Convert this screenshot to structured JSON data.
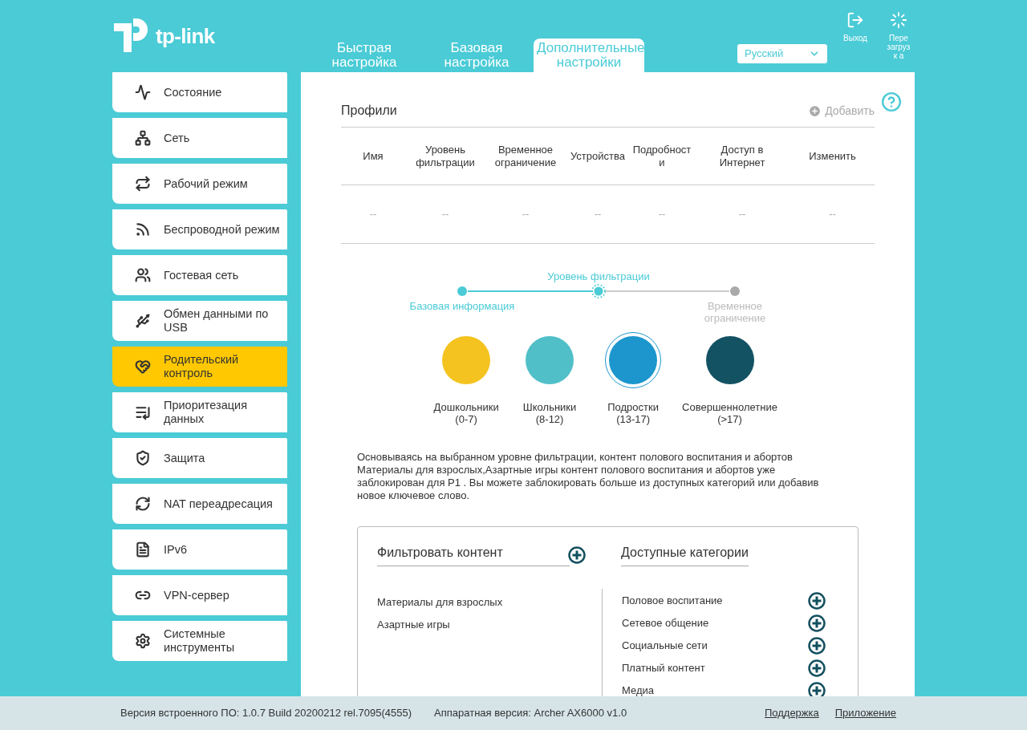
{
  "header": {
    "logo": "tp-link",
    "tabs": [
      {
        "label": "Быстрая настройка",
        "selected": false
      },
      {
        "label": "Базовая настройка",
        "selected": false
      },
      {
        "label": "Дополнительные настройки",
        "selected": true
      }
    ],
    "language": "Русский",
    "actions": [
      {
        "kind": "logout",
        "label": "Выход"
      },
      {
        "kind": "reboot",
        "label": "Пере загрузк а"
      }
    ]
  },
  "sidebar": {
    "items": [
      {
        "label": "Состояние",
        "selected": false
      },
      {
        "label": "Сеть",
        "selected": false
      },
      {
        "label": "Рабочий режим",
        "selected": false
      },
      {
        "label": "Беспроводной режим",
        "selected": false
      },
      {
        "label": "Гостевая сеть",
        "selected": false
      },
      {
        "label": "Обмен данными по USB",
        "selected": false
      },
      {
        "label": "Родительский контроль",
        "selected": true
      },
      {
        "label": "Приоритезация данных",
        "selected": false
      },
      {
        "label": "Защита",
        "selected": false
      },
      {
        "label": "NAT переадресация",
        "selected": false
      },
      {
        "label": "IPv6",
        "selected": false
      },
      {
        "label": "VPN-сервер",
        "selected": false
      },
      {
        "label": "Системные инструменты",
        "selected": false
      }
    ]
  },
  "profiles": {
    "title": "Профили",
    "add": "Добавить",
    "columns": [
      "Имя",
      "Уровень фильтрации",
      "Временное ограничение",
      "Устройства",
      "Подробност и",
      "Доступ в Интернет",
      "Изменить"
    ],
    "rows": [
      [
        "--",
        "--",
        "--",
        "--",
        "--",
        "--",
        "--"
      ]
    ]
  },
  "stepper": [
    {
      "label": "Базовая информация",
      "done": true,
      "selected": false
    },
    {
      "label": "Уровень фильтрации",
      "done": false,
      "selected": true
    },
    {
      "label": "Временное ограничение",
      "done": false,
      "selected": false
    }
  ],
  "levels": [
    {
      "label": "Дошкольники",
      "range": "(0-7)",
      "color": "#f4c320",
      "selected": false
    },
    {
      "label": "Школьники",
      "range": "(8-12)",
      "color": "#50bfc8",
      "selected": false
    },
    {
      "label": "Подростки",
      "range": "(13-17)",
      "color": "#1c96cd",
      "selected": true
    },
    {
      "label": "Совершеннолетние",
      "range": "(>17)",
      "color": "#135263",
      "selected": false
    }
  ],
  "description": "Основываясь на выбранном уровне фильтрации, контент полового воспитания и абортов Материалы для взрослых,Азартные игры контент полового воспитания и абортов уже заблокирован для P1 . Вы можете заблокировать больше из доступных категорий или добавив новое ключевое слово.",
  "filter": {
    "title": "Фильтровать контент",
    "blocked": [
      "Материалы для взрослых",
      "Азартные игры"
    ],
    "available_title": "Доступные категории",
    "available": [
      "Половое воспитание",
      "Сетевое общение",
      "Социальные сети",
      "Платный контент",
      "Медиа"
    ]
  },
  "footer": {
    "firmware": "Версия встроенного ПО: 1.0.7 Build 20200212 rel.7095(4555)",
    "hardware": "Аппаратная версия: Archer AX6000 v1.0",
    "links": [
      "Поддержка",
      "Приложение"
    ]
  }
}
